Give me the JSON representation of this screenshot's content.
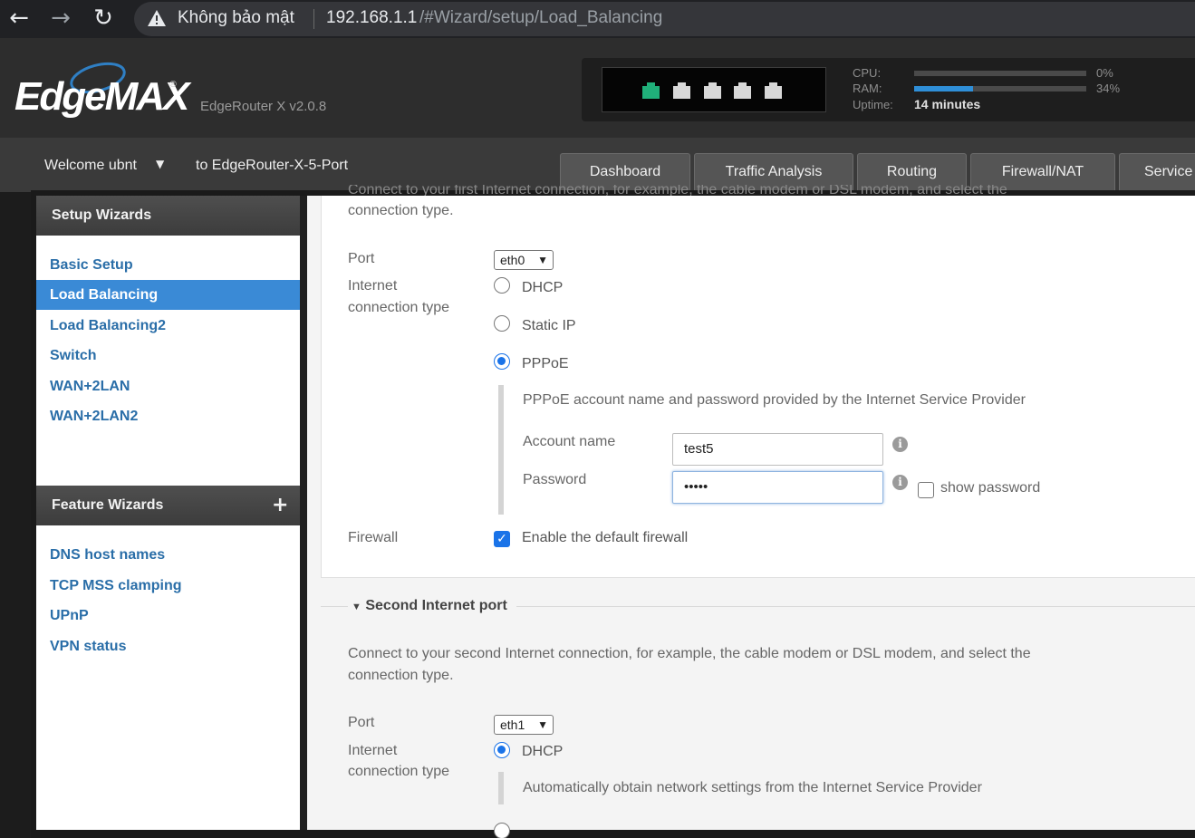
{
  "browser": {
    "back": "←",
    "forward": "→",
    "reload": "↻",
    "security_text": "Không bảo mật",
    "url_host": "192.168.1.1",
    "url_path": "/#Wizard/setup/Load_Balancing"
  },
  "header": {
    "logo": "EdgeMAX",
    "logo_mark": "®",
    "version": "EdgeRouter X v2.0.8",
    "ports": [
      {
        "name": "port-1",
        "active": true
      },
      {
        "name": "port-2",
        "active": false
      },
      {
        "name": "port-3",
        "active": false
      },
      {
        "name": "port-4",
        "active": false
      },
      {
        "name": "port-5",
        "active": false
      }
    ],
    "cpu_label": "CPU:",
    "cpu_pct": "0%",
    "cpu_value": 0,
    "ram_label": "RAM:",
    "ram_pct": "34%",
    "ram_value": 34,
    "uptime_label": "Uptime:",
    "uptime_value": "14 minutes",
    "accent": "#2f8fd8",
    "port_active_color": "#20b07a"
  },
  "nav": {
    "welcome": "Welcome ubnt",
    "device": "to EdgeRouter-X-5-Port",
    "tabs": [
      {
        "label": "Dashboard"
      },
      {
        "label": "Traffic Analysis"
      },
      {
        "label": "Routing"
      },
      {
        "label": "Firewall/NAT"
      },
      {
        "label": "Service"
      }
    ]
  },
  "sidebar": {
    "setup_title": "Setup Wizards",
    "setup_items": [
      {
        "label": "Basic Setup",
        "selected": false
      },
      {
        "label": "Load Balancing",
        "selected": true
      },
      {
        "label": "Load Balancing2",
        "selected": false
      },
      {
        "label": "Switch",
        "selected": false
      },
      {
        "label": "WAN+2LAN",
        "selected": false
      },
      {
        "label": "WAN+2LAN2",
        "selected": false
      }
    ],
    "feature_title": "Feature Wizards",
    "feature_plus": "+",
    "feature_items": [
      {
        "label": "DNS host names"
      },
      {
        "label": "TCP MSS clamping"
      },
      {
        "label": "UPnP"
      },
      {
        "label": "VPN status"
      }
    ]
  },
  "first_port": {
    "cut_text": "Connect to your first Internet connection, for example, the cable modem or DSL modem, and select the",
    "intro_tail": "connection type.",
    "port_label": "Port",
    "port_value": "eth0",
    "conn_label_1": "Internet",
    "conn_label_2": "connection type",
    "opt_dhcp": "DHCP",
    "opt_static": "Static IP",
    "opt_pppoe": "PPPoE",
    "selected": "PPPoE",
    "pppoe_note": "PPPoE account name and password provided by the Internet Service Provider",
    "account_label": "Account name",
    "account_value": "test5",
    "password_label": "Password",
    "password_value": "•••••",
    "show_password": "show password",
    "firewall_label": "Firewall",
    "firewall_option": "Enable the default firewall",
    "firewall_checked": true
  },
  "second_port": {
    "title": "Second Internet port",
    "intro_1": "Connect to your second Internet connection, for example, the cable modem or DSL modem, and select the",
    "intro_2": "connection type.",
    "port_label": "Port",
    "port_value": "eth1",
    "conn_label_1": "Internet",
    "conn_label_2": "connection type",
    "opt_dhcp": "DHCP",
    "selected": "DHCP",
    "dhcp_note": "Automatically obtain network settings from the Internet Service Provider"
  }
}
